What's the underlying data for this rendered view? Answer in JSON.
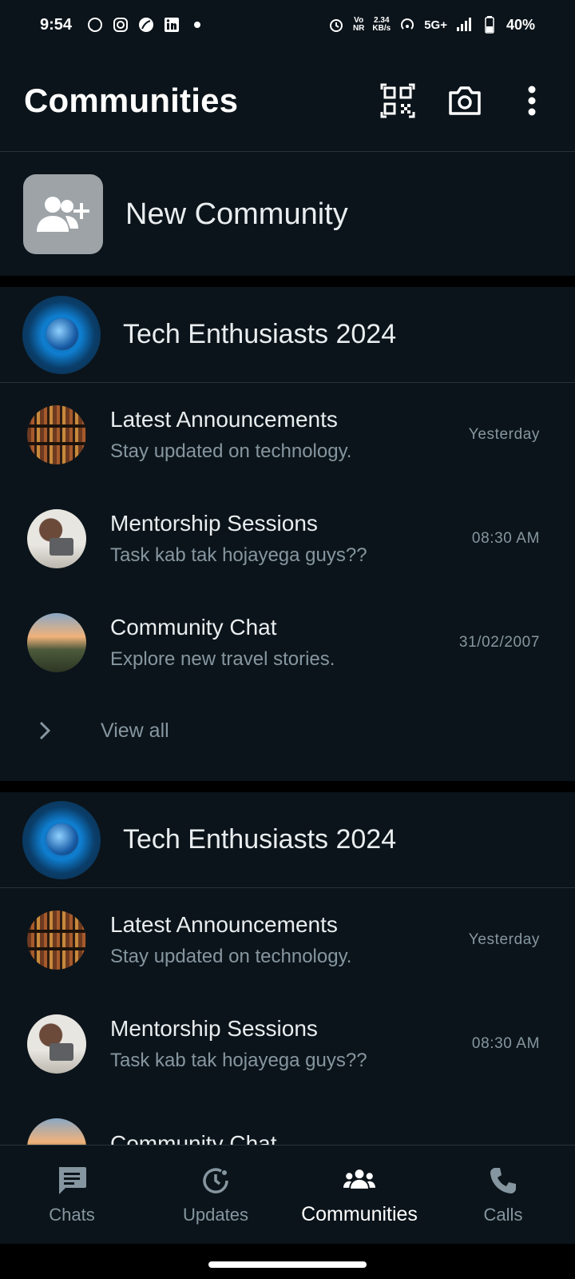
{
  "status_bar": {
    "time": "9:54",
    "left_icons": [
      "whatsapp-icon",
      "instagram-icon",
      "leaf-icon",
      "linkedin-icon",
      "dot-icon"
    ],
    "speed_value": "2.34",
    "speed_unit": "KB/s",
    "network": "5G+",
    "battery": "40%"
  },
  "app_bar": {
    "title": "Communities",
    "actions": [
      "qr-code-icon",
      "camera-icon",
      "more-vert-icon"
    ]
  },
  "new_community": {
    "label": "New Community"
  },
  "communities": [
    {
      "name": "Tech Enthusiasts 2024",
      "groups": [
        {
          "title": "Latest Announcements",
          "subtitle": "Stay updated on technology.",
          "time": "Yesterday",
          "avatar": "books"
        },
        {
          "title": "Mentorship Sessions",
          "subtitle": "Task kab tak hojayega guys??",
          "time": "08:30 AM",
          "avatar": "woman"
        },
        {
          "title": "Community Chat",
          "subtitle": "Explore new travel stories.",
          "time": "31/02/2007",
          "avatar": "landscape"
        }
      ],
      "view_all": "View all"
    },
    {
      "name": "Tech Enthusiasts 2024",
      "groups": [
        {
          "title": "Latest Announcements",
          "subtitle": "Stay updated on technology.",
          "time": "Yesterday",
          "avatar": "books"
        },
        {
          "title": "Mentorship Sessions",
          "subtitle": "Task kab tak hojayega guys??",
          "time": "08:30 AM",
          "avatar": "woman"
        },
        {
          "title": "Community Chat",
          "subtitle": "",
          "time": "",
          "avatar": "landscape"
        }
      ]
    }
  ],
  "bottom_nav": {
    "items": [
      {
        "label": "Chats",
        "icon": "chat-icon"
      },
      {
        "label": "Updates",
        "icon": "updates-icon"
      },
      {
        "label": "Communities",
        "icon": "communities-icon",
        "active": true
      },
      {
        "label": "Calls",
        "icon": "phone-icon"
      }
    ]
  }
}
